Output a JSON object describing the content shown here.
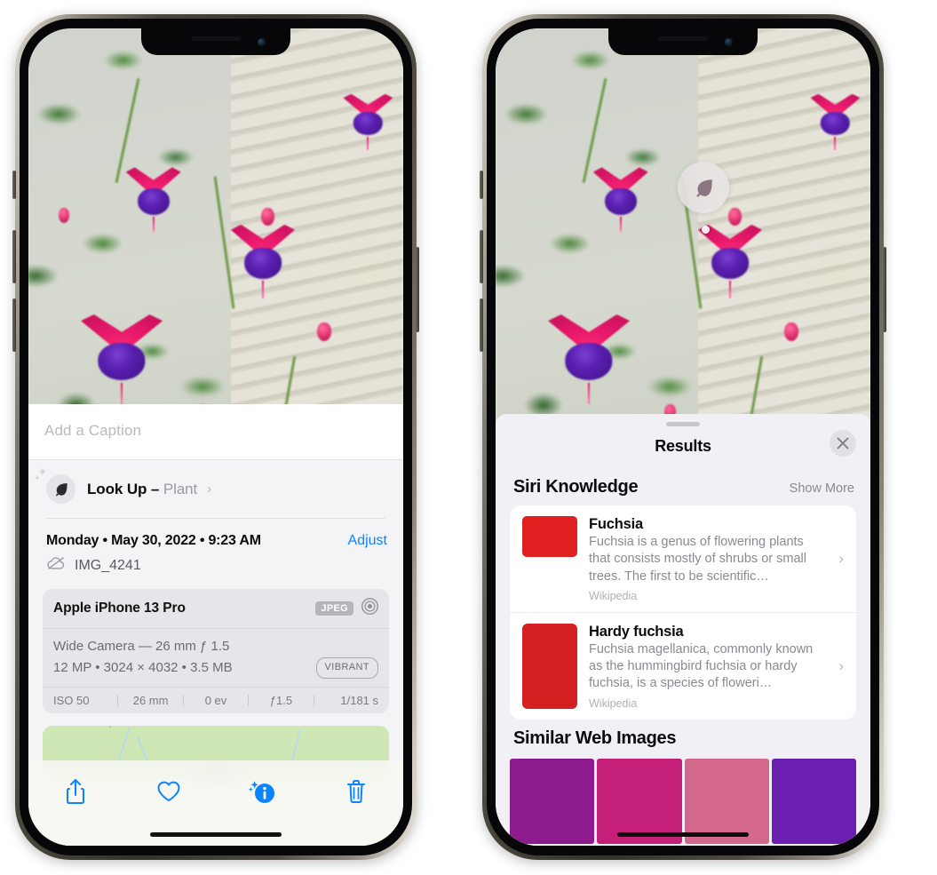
{
  "left_phone": {
    "caption": {
      "placeholder": "Add a Caption",
      "value": ""
    },
    "lookup": {
      "icon": "leaf-icon",
      "sparkle_icon": "sparkles-icon",
      "label": "Look Up – ",
      "subject": "Plant",
      "chevron": "›"
    },
    "details": {
      "datetime": "Monday • May 30, 2022 • 9:23 AM",
      "adjust_label": "Adjust",
      "cloud_icon": "cloud-slash-icon",
      "filename": "IMG_4241"
    },
    "exif": {
      "model": "Apple iPhone 13 Pro",
      "format_badge": "JPEG",
      "lens_icon": "aperture-icon",
      "lens_line": "Wide Camera — 26 mm ƒ 1.5",
      "size_line": "12 MP • 3024 × 4032 • 3.5 MB",
      "profile_badge": "VIBRANT",
      "strip": [
        "ISO 50",
        "26 mm",
        "0 ev",
        "ƒ1.5",
        "1/181 s"
      ]
    },
    "map": {
      "pin": "photo-pin"
    },
    "toolbar": [
      {
        "name": "share-button",
        "icon": "share-icon"
      },
      {
        "name": "favorite-button",
        "icon": "heart-icon"
      },
      {
        "name": "info-button",
        "icon": "info-sparkle-icon"
      },
      {
        "name": "delete-button",
        "icon": "trash-icon"
      }
    ]
  },
  "right_phone": {
    "detection": {
      "icon": "leaf-icon"
    },
    "sheet": {
      "title": "Results",
      "close_icon": "close-icon",
      "grabber": "sheet-grabber"
    },
    "siri_knowledge": {
      "title": "Siri Knowledge",
      "show_more": "Show More",
      "items": [
        {
          "title": "Fuchsia",
          "description": "Fuchsia is a genus of flowering plants that consists mostly of shrubs or small trees. The first to be scientific…",
          "source": "Wikipedia",
          "chevron": "›"
        },
        {
          "title": "Hardy fuchsia",
          "description": "Fuchsia magellanica, commonly known as the hummingbird fuchsia or hardy fuchsia, is a species of floweri…",
          "source": "Wikipedia",
          "chevron": "›"
        }
      ]
    },
    "similar_web_images": {
      "title": "Similar Web Images",
      "tiles": [
        "fuchsia-pink-white",
        "fuchsia-red-closeup",
        "fuchsia-bush",
        "fuchsia-purple-red"
      ]
    }
  },
  "colors": {
    "accent_blue": "#0a84ff",
    "sheet_bg": "#f1f0f5",
    "info_bg": "#f4f4f6",
    "card_bg": "#ffffff",
    "exif_bg": "#e6e6ea",
    "secondary_text": "#8a8a90"
  }
}
